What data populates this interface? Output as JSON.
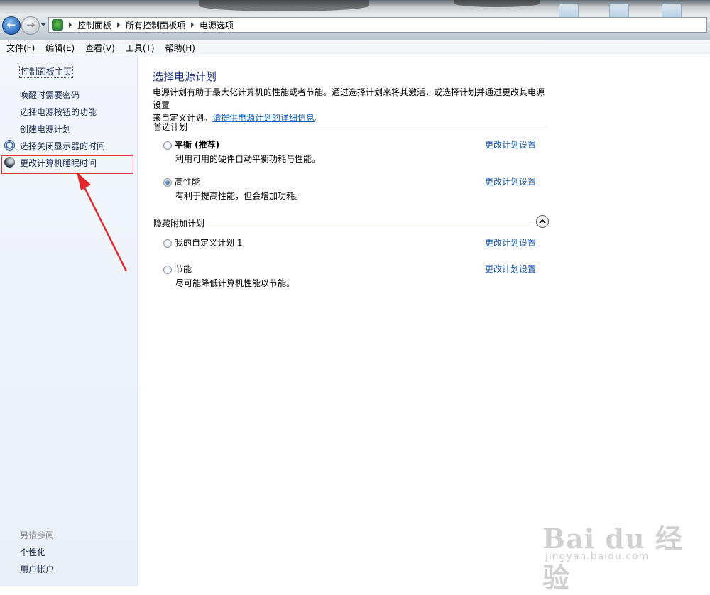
{
  "address_bar": {
    "breadcrumbs": [
      "控制面板",
      "所有控制面板项",
      "电源选项"
    ]
  },
  "menu": [
    "文件(F)",
    "编辑(E)",
    "查看(V)",
    "工具(T)",
    "帮助(H)"
  ],
  "sidebar": {
    "home_link": "控制面板主页",
    "links": [
      "唤醒时需要密码",
      "选择电源按钮的功能",
      "创建电源计划",
      "选择关闭显示器的时间",
      "更改计算机睡眠时间"
    ],
    "see_also_title": "另请参阅",
    "see_also": [
      "个性化",
      "用户帐户"
    ]
  },
  "main": {
    "title": "选择电源计划",
    "description_line1": "电源计划有助于最大化计算机的性能或者节能。通过选择计划来将其激活，或选择计划并通过更改其电源设置",
    "description_line2": "来自定义计划。",
    "description_link": "请提供电源计划的详细信息",
    "description_end": "。",
    "preferred_section": "首选计划",
    "hidden_section": "隐藏附加计划",
    "change_link": "更改计划设置",
    "plans": [
      {
        "name": "平衡 (推荐)",
        "desc": "利用可用的硬件自动平衡功耗与性能。",
        "selected": false
      },
      {
        "name": "高性能",
        "desc": "有利于提高性能，但会增加功耗。",
        "selected": true
      },
      {
        "name": "我的自定义计划 1",
        "desc": "",
        "selected": false
      },
      {
        "name": "节能",
        "desc": "尽可能降低计算机性能以节能。",
        "selected": false
      }
    ]
  },
  "watermark": {
    "main": "Bai du 经验",
    "sub": "jingyan.baidu.com"
  },
  "colors": {
    "link": "#1b5bb0",
    "title": "#1e3287",
    "highlight_box": "#e0363b",
    "arrow": "#e4262b"
  },
  "icons": {
    "back": "back-arrow-icon",
    "forward": "forward-arrow-icon",
    "control_panel": "control-panel-icon",
    "display_timer": "clock-icon",
    "sleep": "moon-icon",
    "collapse": "chevron-up-icon"
  }
}
